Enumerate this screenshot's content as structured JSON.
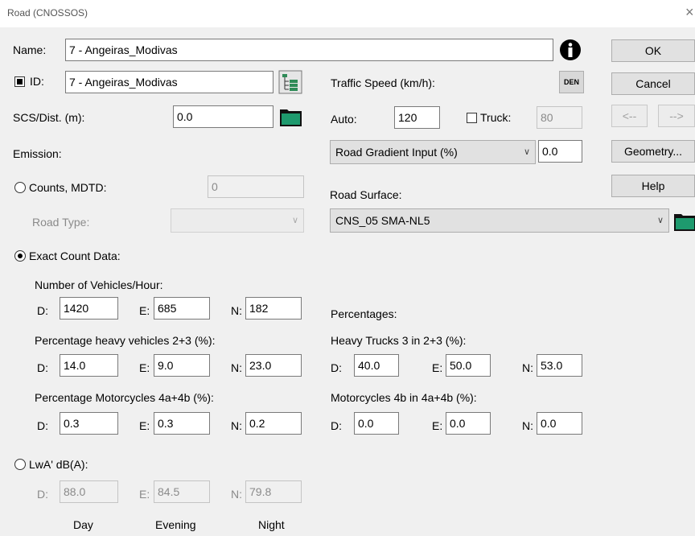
{
  "window": {
    "title": "Road (CNOSSOS)",
    "close_glyph": "×"
  },
  "name": {
    "label": "Name:",
    "value": "7 - Angeiras_Modivas",
    "info_icon": "info-icon"
  },
  "id": {
    "label": "ID:",
    "value": "7 - Angeiras_Modivas",
    "checked": true,
    "icon": "list-tree-icon"
  },
  "scs": {
    "label": "SCS/Dist. (m):",
    "value": "0.0",
    "icon": "folder-icon"
  },
  "emission": {
    "label": "Emission:"
  },
  "counts": {
    "label": "Counts, MDTD:",
    "value": "0",
    "road_type_label": "Road Type:",
    "road_type_value": ""
  },
  "traffic_speed": {
    "label": "Traffic Speed (km/h):",
    "den_label": "DEN",
    "auto_label": "Auto:",
    "auto_value": "120",
    "truck_label": "Truck:",
    "truck_value": "80",
    "truck_checked": false
  },
  "gradient": {
    "selected": "Road Gradient Input (%)",
    "value": "0.0"
  },
  "surface": {
    "label": "Road Surface:",
    "selected": "CNS_05 SMA-NL5"
  },
  "buttons": {
    "ok": "OK",
    "cancel": "Cancel",
    "prev": "<--",
    "next": "-->",
    "geometry": "Geometry...",
    "help": "Help"
  },
  "exact": {
    "label": "Exact Count Data:",
    "selected": true
  },
  "labels": {
    "d": "D:",
    "e": "E:",
    "n": "N:"
  },
  "vehicles": {
    "label": "Number of Vehicles/Hour:",
    "d": "1420",
    "e": "685",
    "n": "182"
  },
  "percentages": {
    "label": "Percentages:"
  },
  "heavy": {
    "label": "Percentage heavy vehicles 2+3 (%):",
    "d": "14.0",
    "e": "9.0",
    "n": "23.0"
  },
  "trucks3": {
    "label": "Heavy Trucks 3 in 2+3 (%):",
    "d": "40.0",
    "e": "50.0",
    "n": "53.0"
  },
  "motor": {
    "label": "Percentage Motorcycles  4a+4b (%):",
    "d": "0.3",
    "e": "0.3",
    "n": "0.2"
  },
  "motor4b": {
    "label": "Motorcycles 4b in 4a+4b (%):",
    "d": "0.0",
    "e": "0.0",
    "n": "0.0"
  },
  "lwa": {
    "label": "LwA' dB(A):",
    "d": "88.0",
    "e": "84.5",
    "n": "79.8",
    "day": "Day",
    "evening": "Evening",
    "night": "Night"
  },
  "colors": {
    "field_border": "#7a7a7a",
    "folder_green": "#1e9a6e",
    "dialog_bg": "#f0f0f0"
  }
}
